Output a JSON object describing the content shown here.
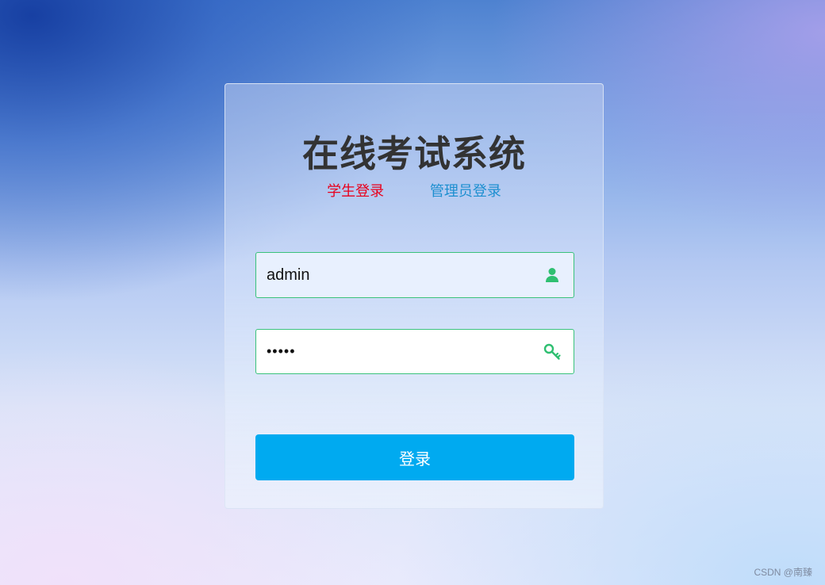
{
  "app": {
    "title": "在线考试系统"
  },
  "tabs": {
    "student_label": "学生登录",
    "admin_label": "管理员登录",
    "student_color": "#e8001c",
    "admin_color": "#1d8fd0"
  },
  "form": {
    "username_value": "admin",
    "password_value": "•••••",
    "username_icon": "user-icon",
    "password_icon": "key-icon",
    "border_color": "#3ac27c"
  },
  "login_button": {
    "label": "登录",
    "color": "#00aaf0"
  },
  "watermark": {
    "text": "CSDN @南臻"
  }
}
